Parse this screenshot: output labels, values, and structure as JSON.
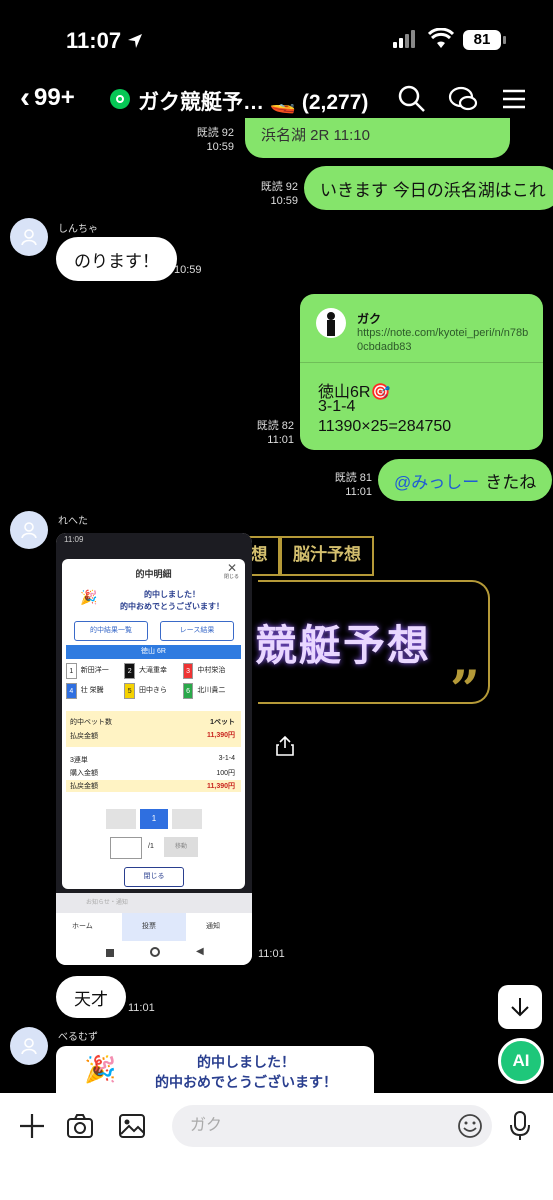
{
  "status": {
    "time": "11:07",
    "battery": "81"
  },
  "header": {
    "back_count": "99+",
    "title": "ガク競艇予…",
    "member_count": "(2,277)"
  },
  "messages": {
    "m1": {
      "text": "浜名湖 2R 11:10",
      "read": "既読 92",
      "time": "10:59"
    },
    "m2": {
      "text": "いきます 今日の浜名湖はこれ",
      "read": "既読 92",
      "time": "10:59"
    },
    "m3": {
      "sender": "しんちゃ",
      "text": "のります！",
      "time": "10:59"
    },
    "m4": {
      "link_author": "ガク",
      "link_url": "https://note.com/kyotei_peri/n/n78b0cbdadb83",
      "line1": "徳山6R🎯",
      "line2": "3-1-4",
      "line3": "11390×25=284750",
      "read": "既読 82",
      "time": "11:01"
    },
    "m5": {
      "mention": "@みっしー",
      "text": "きたね",
      "read": "既読 81",
      "time": "11:01"
    },
    "m6": {
      "sender": "れへた",
      "time": "11:01",
      "shot": {
        "status_time": "11:09",
        "popup_title": "的中明細",
        "close_label": "閉じる",
        "congrats1": "的中しました！",
        "congrats2": "的中おめでとうございます！",
        "btn_list": "的中結果一覧",
        "btn_result": "レース結果",
        "race": "徳山 6R",
        "horses": [
          {
            "no": "1",
            "name": "新田洋一"
          },
          {
            "no": "2",
            "name": "大滝重幸"
          },
          {
            "no": "3",
            "name": "中村栄治"
          },
          {
            "no": "4",
            "name": "壮 栄騰"
          },
          {
            "no": "5",
            "name": "田中きら"
          },
          {
            "no": "6",
            "name": "北川貴二"
          }
        ],
        "hit_bets_label": "的中ベット数",
        "hit_bets_value": "1ベット",
        "payout_label": "払戻金額",
        "payout_value": "11,390円",
        "bet_type": "3連単",
        "combo": "3-1-4",
        "buy_label": "購入金額",
        "buy_value": "100円",
        "payout2_label": "払戻金額",
        "payout2_value": "11,390円",
        "page": "1",
        "page_total": "/1",
        "move_btn": "移動",
        "close_btn": "閉じる",
        "notice": "お知らせ・通知",
        "tabs": [
          "ホーム",
          "投票",
          "通知"
        ]
      }
    },
    "m7": {
      "text": "天才",
      "time": "11:01"
    },
    "m8": {
      "sender": "べるむず",
      "line1": "的中しました！",
      "line2": "的中おめでとうございます！"
    }
  },
  "background_art": {
    "tab1": "想",
    "tab2": "脳汁予想",
    "headline": "競艇予想"
  },
  "composer": {
    "placeholder": "ガク",
    "ai_label": "AI"
  },
  "colors": {
    "bubble_green": "#85e46b",
    "line_green": "#06c755",
    "mention_blue": "#1f5bd6"
  }
}
